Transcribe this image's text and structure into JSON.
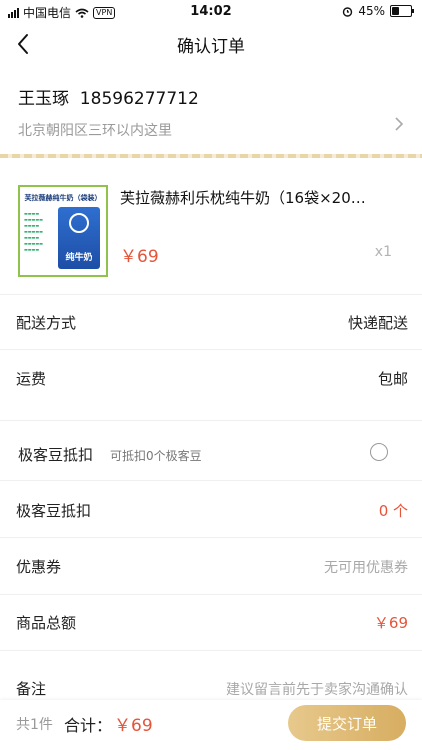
{
  "status_bar": {
    "carrier": "中国电信",
    "vpn": "VPN",
    "time": "14:02",
    "battery": "45%",
    "battery_level": 0.45
  },
  "nav": {
    "title": "确认订单"
  },
  "address": {
    "name_phone": "王玉琢  18596277712",
    "line": "北京朝阳区三环以内这里"
  },
  "product": {
    "title": "芙拉薇赫利乐枕纯牛奶（16袋×20…",
    "price": "￥69",
    "qty": "x1",
    "image_caption": "芙拉薇赫纯牛奶（袋装）",
    "image_pack_label": "纯牛奶"
  },
  "rows": {
    "delivery": {
      "label": "配送方式",
      "value": "快递配送"
    },
    "shipping": {
      "label": "运费",
      "value": "包邮"
    },
    "beans_toggle": {
      "label": "极客豆抵扣",
      "sub": "可抵扣0个极客豆"
    },
    "beans": {
      "label": "极客豆抵扣",
      "value": "0 个"
    },
    "coupon": {
      "label": "优惠券",
      "value": "无可用优惠券"
    },
    "total": {
      "label": "商品总额",
      "value": "￥69"
    },
    "note": {
      "label": "备注",
      "placeholder": "建议留言前先于卖家沟通确认"
    }
  },
  "bottom": {
    "count": "共1件",
    "sum_label": "合计：",
    "sum_value": "￥69",
    "submit": "提交订单"
  },
  "colors": {
    "accent_red": "#e4553a",
    "button_gold": "#d7ad61"
  }
}
